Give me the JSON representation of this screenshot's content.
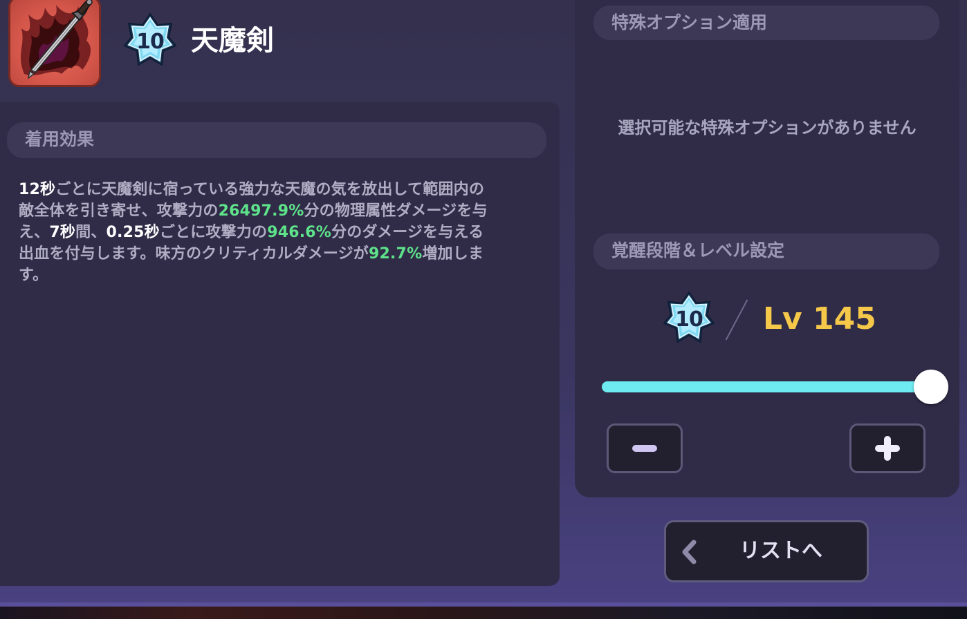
{
  "item": {
    "icon": "sword-icon",
    "awakening": "10",
    "name": "天魔剣"
  },
  "effect_panel": {
    "header": "着用効果",
    "description": {
      "line1": [
        {
          "t": "12秒",
          "c": "w"
        },
        {
          "t": "ごとに天魔剣に宿っている強力な天魔の気を放出して範囲内の",
          "c": "n"
        }
      ],
      "line2": [
        {
          "t": "敵全体を引き寄せ、攻撃力の",
          "c": "n"
        },
        {
          "t": "26497.9%",
          "c": "g"
        },
        {
          "t": "分の物理属性ダメージを与",
          "c": "n"
        }
      ],
      "line3": [
        {
          "t": "え、",
          "c": "n"
        },
        {
          "t": "7秒",
          "c": "w"
        },
        {
          "t": "間、",
          "c": "n"
        },
        {
          "t": "0.25秒",
          "c": "w"
        },
        {
          "t": "ごとに攻撃力の",
          "c": "n"
        },
        {
          "t": "946.6%",
          "c": "g"
        },
        {
          "t": "分のダメージを与える",
          "c": "n"
        }
      ],
      "line4": [
        {
          "t": "出血を付与します。味方のクリティカルダメージが",
          "c": "n"
        },
        {
          "t": "92.7%",
          "c": "g"
        },
        {
          "t": "増加しま",
          "c": "n"
        }
      ],
      "line5": [
        {
          "t": "す。",
          "c": "n"
        }
      ]
    }
  },
  "special_option": {
    "header": "特殊オプション適用",
    "empty_message": "選択可能な特殊オプションがありません"
  },
  "awakening_settings": {
    "header": "覚醒段階＆レベル設定",
    "awakening": "10",
    "level_label": "Lv 145",
    "slider": {
      "value": 1.0
    },
    "minus_icon": "minus-icon",
    "plus_icon": "plus-icon"
  },
  "back_button": {
    "icon": "chevron-left-icon",
    "label": "リストへ"
  },
  "colors": {
    "highlight_green": "#5ee28a",
    "level_gold": "#f5c84a",
    "slider_cyan": "#6eebf0"
  }
}
